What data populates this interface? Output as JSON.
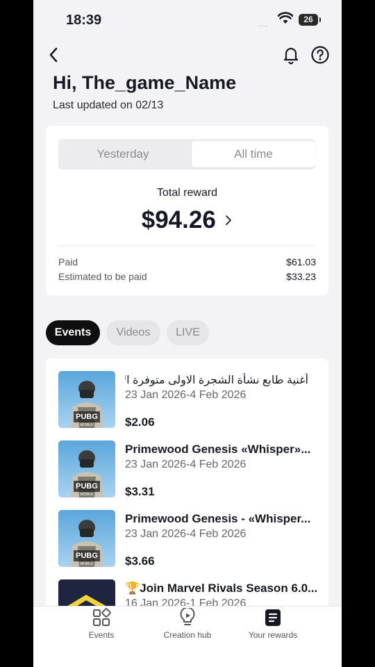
{
  "status_bar": {
    "time": "18:39",
    "signal": "....",
    "battery": "26"
  },
  "header": {
    "greeting": "Hi, The_game_Name",
    "last_updated": "Last updated on 02/13"
  },
  "reward_card": {
    "tabs": [
      "Yesterday",
      "All time"
    ],
    "selected_tab": "All time",
    "total_label": "Total reward",
    "total_amount": "$94.26",
    "paid_label": "Paid",
    "paid_value": "$61.03",
    "estimated_label": "Estimated to be paid",
    "estimated_value": "$33.23"
  },
  "filter_pills": [
    "Events",
    "Videos",
    "LIVE"
  ],
  "events": [
    {
      "title": "أغنية طابع نشأة الشجرة الاولى متوفرة الان...",
      "dates": "23 Jan 2026-4 Feb 2026",
      "amount": "$2.06",
      "thumb_text": "PUBG",
      "thumb_sub": "MOBILE"
    },
    {
      "title": "Primewood Genesis «Whisper»...",
      "dates": "23 Jan 2026-4 Feb 2026",
      "amount": "$3.31",
      "thumb_text": "PUBG",
      "thumb_sub": "MOBILE"
    },
    {
      "title": "Primewood Genesis - «Whisper...",
      "dates": "23 Jan 2026-4 Feb 2026",
      "amount": "$3.66",
      "thumb_text": "PUBG",
      "thumb_sub": "MOBILE"
    },
    {
      "title": "🏆Join Marvel Rivals Season 6.0...",
      "dates": "16 Jan 2026-1 Feb 2026",
      "amount": ""
    }
  ],
  "tab_bar": {
    "items": [
      {
        "label": "Events",
        "icon": "events-grid-icon"
      },
      {
        "label": "Creation hub",
        "icon": "lightbulb-play-icon"
      },
      {
        "label": "Your rewards",
        "icon": "rewards-document-icon"
      }
    ]
  },
  "colors": {
    "accent_dark": "#0f0f10",
    "background": "#f3f3f5",
    "card": "#ffffff",
    "muted": "#8a8b91"
  }
}
